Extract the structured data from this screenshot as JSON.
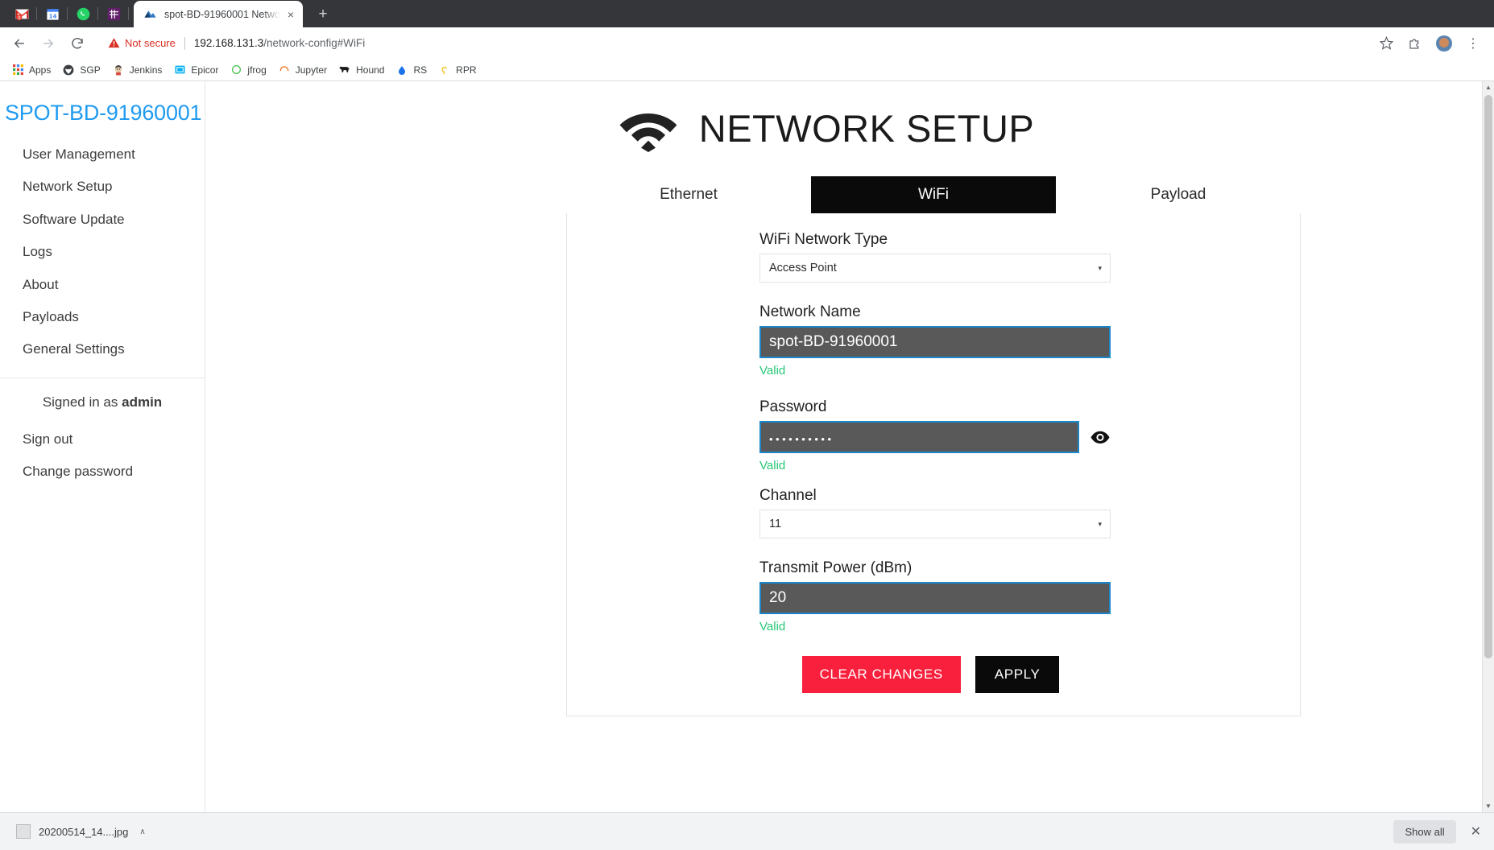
{
  "browser": {
    "pinned_tabs": [
      {
        "name": "gmail-pinned-tab",
        "icon": "gmail-icon"
      },
      {
        "name": "calendar-pinned-tab",
        "icon": "calendar-icon",
        "label": "14"
      },
      {
        "name": "whatsapp-pinned-tab",
        "icon": "whatsapp-icon"
      },
      {
        "name": "slack-pinned-tab",
        "icon": "slack-icon"
      }
    ],
    "active_tab": {
      "title": "spot-BD-91960001 Netwo",
      "favicon": "page-favicon",
      "close_label": "×"
    },
    "new_tab_label": "+",
    "nav": {
      "back": "←",
      "forward": "→",
      "reload": "⟳"
    },
    "omnibox": {
      "security_text": "Not secure",
      "url_host": "192.168.131.3",
      "url_path": "/network-config#WiFi"
    },
    "toolbar_right": {
      "bookmark_star": "☆",
      "extension": "extension-icon",
      "profile": "profile-avatar",
      "menu": "⋮"
    },
    "bookmarks": [
      {
        "label": "Apps",
        "icon": "apps-grid-icon"
      },
      {
        "label": "SGP",
        "icon": "sgp-icon"
      },
      {
        "label": "Jenkins",
        "icon": "jenkins-icon"
      },
      {
        "label": "Epicor",
        "icon": "epicor-icon"
      },
      {
        "label": "jfrog",
        "icon": "jfrog-icon"
      },
      {
        "label": "Jupyter",
        "icon": "jupyter-icon"
      },
      {
        "label": "Hound",
        "icon": "hound-icon"
      },
      {
        "label": "RS",
        "icon": "rs-icon"
      },
      {
        "label": "RPR",
        "icon": "rpr-icon"
      }
    ]
  },
  "sidebar": {
    "brand": "SPOT-BD-91960001",
    "items": [
      {
        "label": "User Management"
      },
      {
        "label": "Network Setup"
      },
      {
        "label": "Software Update"
      },
      {
        "label": "Logs"
      },
      {
        "label": "About"
      },
      {
        "label": "Payloads"
      },
      {
        "label": "General Settings"
      }
    ],
    "signed_in_prefix": "Signed in as ",
    "signed_in_user": "admin",
    "auth_items": [
      {
        "label": "Sign out"
      },
      {
        "label": "Change password"
      }
    ]
  },
  "main": {
    "title": "NETWORK SETUP",
    "wifi_icon": "wifi-icon",
    "tabs": [
      {
        "label": "Ethernet",
        "active": false
      },
      {
        "label": "WiFi",
        "active": true
      },
      {
        "label": "Payload",
        "active": false
      }
    ],
    "fields": {
      "network_type": {
        "label": "WiFi Network Type",
        "value": "Access Point",
        "caret": "▾"
      },
      "network_name": {
        "label": "Network Name",
        "value": "spot-BD-91960001",
        "status": "Valid"
      },
      "password": {
        "label": "Password",
        "value": "••••••••••",
        "status": "Valid",
        "toggle_icon": "eye-icon"
      },
      "channel": {
        "label": "Channel",
        "value": "11",
        "caret": "▾"
      },
      "transmit_power": {
        "label": "Transmit Power (dBm)",
        "value": "20",
        "status": "Valid"
      }
    },
    "buttons": {
      "clear": "CLEAR CHANGES",
      "apply": "APPLY"
    },
    "colors": {
      "brand_blue": "#1f9bf0",
      "input_bg": "#595959",
      "input_border": "#1b87c9",
      "valid_green": "#27c776",
      "danger_red": "#f8203c",
      "active_tab_bg": "#0a0a0a"
    }
  },
  "downloads": {
    "file_name": "20200514_14....jpg",
    "item_caret": "∧",
    "show_all": "Show all",
    "close": "✕"
  }
}
